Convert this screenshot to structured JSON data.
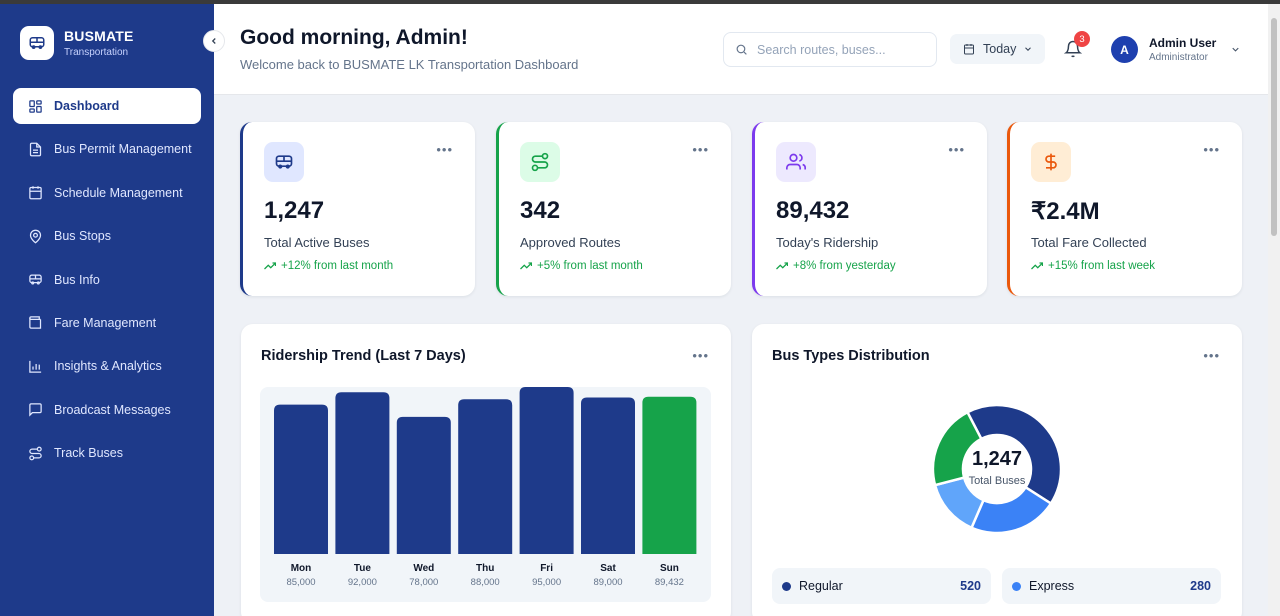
{
  "brand": {
    "name": "BUSMATE",
    "subtitle": "Transportation"
  },
  "sidebar": {
    "items": [
      {
        "label": "Dashboard",
        "icon": "dashboard-icon",
        "active": true
      },
      {
        "label": "Bus Permit Management",
        "icon": "document-icon"
      },
      {
        "label": "Schedule Management",
        "icon": "calendar-icon"
      },
      {
        "label": "Bus Stops",
        "icon": "map-pin-icon"
      },
      {
        "label": "Bus Info",
        "icon": "bus-icon"
      },
      {
        "label": "Fare Management",
        "icon": "wallet-icon"
      },
      {
        "label": "Insights & Analytics",
        "icon": "bar-chart-icon"
      },
      {
        "label": "Broadcast Messages",
        "icon": "message-icon"
      },
      {
        "label": "Track Buses",
        "icon": "route-icon"
      }
    ]
  },
  "header": {
    "greeting": "Good morning, Admin!",
    "subtitle": "Welcome back to BUSMATE LK Transportation Dashboard",
    "search_placeholder": "Search routes, buses...",
    "date_filter": "Today",
    "notification_count": "3",
    "user": {
      "initial": "A",
      "name": "Admin User",
      "role": "Administrator"
    }
  },
  "stats": [
    {
      "value": "1,247",
      "label": "Total Active Buses",
      "trend": "+12% from last month",
      "icon": "bus-icon",
      "accent": "#1e3a8a",
      "icon_bg": "#e0e7ff",
      "icon_color": "#1e3a8a"
    },
    {
      "value": "342",
      "label": "Approved Routes",
      "trend": "+5% from last month",
      "icon": "route-icon",
      "accent": "#16a34a",
      "icon_bg": "#dcfce7",
      "icon_color": "#16a34a"
    },
    {
      "value": "89,432",
      "label": "Today's Ridership",
      "trend": "+8% from yesterday",
      "icon": "users-icon",
      "accent": "#7c3aed",
      "icon_bg": "#ede9fe",
      "icon_color": "#7c3aed"
    },
    {
      "value": "₹2.4M",
      "label": "Total Fare Collected",
      "trend": "+15% from last week",
      "icon": "rupee-icon",
      "accent": "#ea580c",
      "icon_bg": "#ffedd5",
      "icon_color": "#ea580c"
    }
  ],
  "ridership": {
    "title": "Ridership Trend (Last 7 Days)",
    "value_labels": [
      "85,000",
      "92,000",
      "78,000",
      "88,000",
      "95,000",
      "89,000",
      "89,432"
    ]
  },
  "bus_types": {
    "title": "Bus Types Distribution",
    "center_value": "1,247",
    "center_label": "Total Buses",
    "legend": [
      {
        "label": "Regular",
        "value": "520",
        "color": "#1e3a8a"
      },
      {
        "label": "Express",
        "value": "280",
        "color": "#3b82f6"
      }
    ]
  },
  "chart_data": [
    {
      "type": "bar",
      "title": "Ridership Trend (Last 7 Days)",
      "categories": [
        "Mon",
        "Tue",
        "Wed",
        "Thu",
        "Fri",
        "Sat",
        "Sun"
      ],
      "values": [
        85000,
        92000,
        78000,
        88000,
        95000,
        89000,
        89432
      ],
      "colors": [
        "#1e3a8a",
        "#1e3a8a",
        "#1e3a8a",
        "#1e3a8a",
        "#1e3a8a",
        "#1e3a8a",
        "#16a34a"
      ],
      "xlabel": "",
      "ylabel": "",
      "grid": false
    },
    {
      "type": "pie",
      "title": "Bus Types Distribution",
      "donut": true,
      "slices": [
        {
          "label": "Regular",
          "value": 520,
          "color": "#1e3a8a"
        },
        {
          "label": "Express",
          "value": 280,
          "color": "#3b82f6"
        },
        {
          "value": 180,
          "color": "#60a5fa"
        },
        {
          "value": 267,
          "color": "#16a34a"
        }
      ]
    }
  ]
}
